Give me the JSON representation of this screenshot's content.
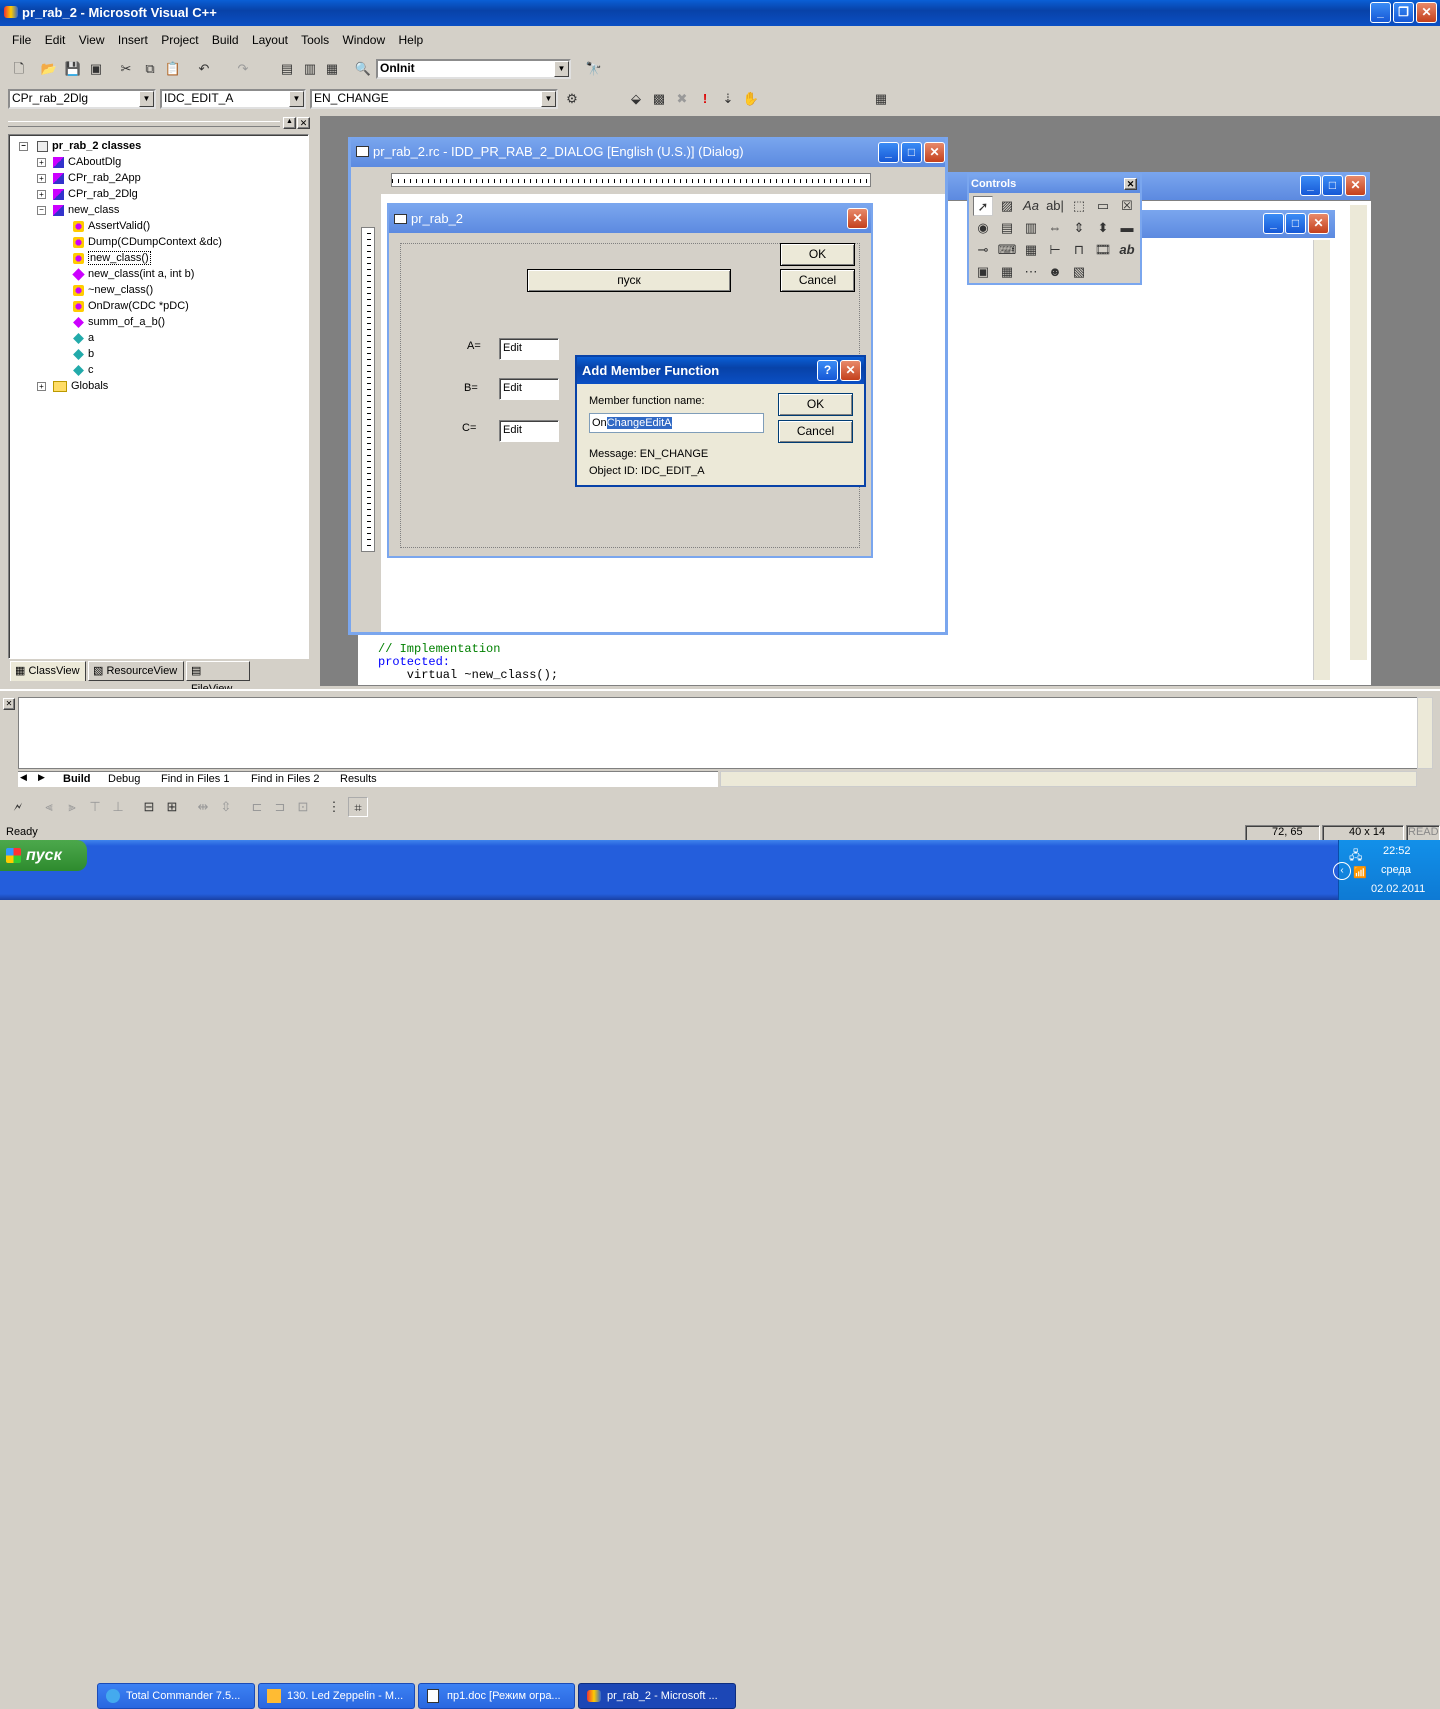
{
  "app": {
    "title": "pr_rab_2 - Microsoft Visual C++"
  },
  "menu": [
    "File",
    "Edit",
    "View",
    "Insert",
    "Project",
    "Build",
    "Layout",
    "Tools",
    "Window",
    "Help"
  ],
  "toolbar": {
    "function_combo": "OnInit"
  },
  "wizardbar": {
    "class_combo": "CPr_rab_2Dlg",
    "id_combo": "IDC_EDIT_A",
    "message_combo": "EN_CHANGE"
  },
  "classview": {
    "root": "pr_rab_2 classes",
    "classes": [
      "CAboutDlg",
      "CPr_rab_2App",
      "CPr_rab_2Dlg",
      "new_class"
    ],
    "members": [
      "AssertValid()",
      "Dump(CDumpContext &dc)",
      "new_class()",
      "new_class(int a, int b)",
      "~new_class()",
      "OnDraw(CDC *pDC)",
      "summ_of_a_b()",
      "a",
      "b",
      "c"
    ],
    "globals": "Globals",
    "tabs": [
      "ClassView",
      "ResourceView",
      "FileView"
    ]
  },
  "rc_window": {
    "title": "pr_rab_2.rc - IDD_PR_RAB_2_DIALOG [English (U.S.)] (Dialog)"
  },
  "dialog": {
    "title": "pr_rab_2",
    "ok": "OK",
    "cancel": "Cancel",
    "pusk": "пуск",
    "label_a": "A=",
    "label_b": "B=",
    "label_c": "C=",
    "edit_a": "Edit",
    "edit_b": "Edit",
    "edit_c": "Edit"
  },
  "controls": {
    "title": "Controls"
  },
  "code": {
    "line1": "// Implementation",
    "line2": "protected:",
    "line3": "    virtual ~new_class();"
  },
  "add_member": {
    "title": "Add Member Function",
    "name_label": "Member function name:",
    "name_prefix": "On",
    "name_selected": "ChangeEditA",
    "ok": "OK",
    "cancel": "Cancel",
    "message": "Message: EN_CHANGE",
    "object": "Object ID: IDC_EDIT_A"
  },
  "output": {
    "tabs": [
      "Build",
      "Debug",
      "Find in Files 1",
      "Find in Files 2",
      "Results"
    ]
  },
  "status": {
    "text": "Ready",
    "pos": "72, 65",
    "size": "40 x 14",
    "mode": "READ"
  },
  "taskbar": {
    "start": "пуск",
    "items": [
      "Total Commander 7.5...",
      "130. Led Zeppelin - M...",
      "пр1.doc [Режим огра...",
      "pr_rab_2 - Microsoft ..."
    ],
    "time": "22:52",
    "day": "среда",
    "date": "02.02.2011"
  }
}
